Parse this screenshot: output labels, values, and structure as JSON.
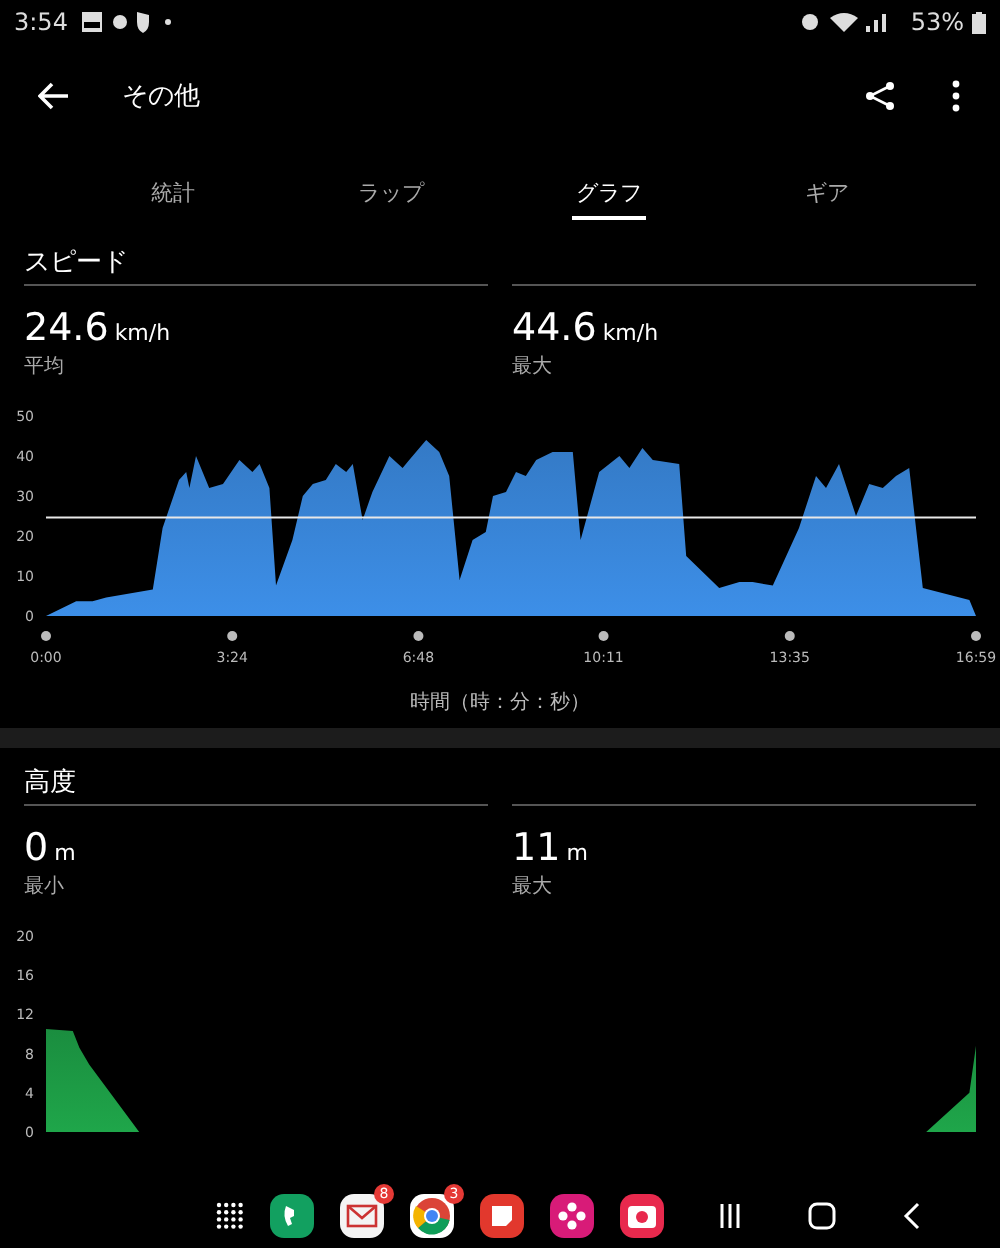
{
  "status_bar": {
    "time": "3:54",
    "battery": "53%"
  },
  "app_bar": {
    "title": "その他"
  },
  "tabs": [
    {
      "label": "統計",
      "selected": false
    },
    {
      "label": "ラップ",
      "selected": false
    },
    {
      "label": "グラフ",
      "selected": true
    },
    {
      "label": "ギア",
      "selected": false
    }
  ],
  "sections": [
    {
      "title": "スピード",
      "stats": [
        {
          "value": "24.6",
          "unit": "km/h",
          "label": "平均"
        },
        {
          "value": "44.6",
          "unit": "km/h",
          "label": "最大"
        }
      ],
      "chart_data": {
        "type": "area",
        "xlabel": "時間（時：分：秒）",
        "ylim": [
          0,
          50
        ],
        "xlim": [
          0,
          16.98
        ],
        "yticks": [
          0,
          10,
          20,
          30,
          40,
          50
        ],
        "xticks": [
          {
            "value": 0,
            "label": "0:00"
          },
          {
            "value": 3.4,
            "label": "3:24"
          },
          {
            "value": 6.8,
            "label": "6:48"
          },
          {
            "value": 10.18,
            "label": "10:11"
          },
          {
            "value": 13.58,
            "label": "13:35"
          },
          {
            "value": 16.98,
            "label": "16:59"
          }
        ],
        "x": [
          0,
          0.55,
          0.85,
          1.1,
          1.95,
          2.13,
          2.43,
          2.56,
          2.62,
          2.74,
          2.98,
          3.23,
          3.53,
          3.77,
          3.9,
          4.08,
          4.2,
          4.5,
          4.69,
          4.87,
          5.11,
          5.29,
          5.48,
          5.6,
          5.78,
          5.96,
          6.27,
          6.51,
          6.63,
          6.94,
          7.18,
          7.36,
          7.55,
          7.79,
          8.03,
          8.16,
          8.4,
          8.58,
          8.76,
          8.95,
          9.25,
          9.62,
          9.76,
          10.1,
          10.47,
          10.65,
          10.89,
          11.08,
          11.56,
          11.69,
          12.29,
          12.66,
          12.9,
          13.27,
          13.75,
          14.06,
          14.24,
          14.48,
          14.79,
          15.03,
          15.28,
          15.52,
          15.76,
          16.01,
          16.86,
          16.98
        ],
        "series": [
          {
            "color": "#3d8fe8",
            "values": [
              0,
              3.7,
              3.7,
              4.6,
              6.6,
              22,
              34,
              36,
              32,
              40,
              32,
              33,
              39,
              36,
              38,
              32,
              7.6,
              19,
              30,
              33,
              34,
              38,
              36,
              38,
              24,
              31,
              40,
              37,
              39,
              44,
              41,
              35,
              9,
              19,
              21,
              30,
              31,
              36,
              35,
              39,
              41,
              41,
              19,
              36,
              40,
              37,
              42,
              39,
              38,
              15,
              7,
              8.5,
              8.5,
              7.6,
              22,
              35,
              32,
              38,
              25,
              33,
              32,
              35,
              37,
              7,
              4,
              0
            ]
          }
        ],
        "ref_lines": [
          {
            "axis": "y",
            "value": 24.6
          }
        ]
      }
    },
    {
      "title": "高度",
      "stats": [
        {
          "value": "0",
          "unit": "m",
          "label": "最小"
        },
        {
          "value": "11",
          "unit": "m",
          "label": "最大"
        }
      ],
      "chart_data": {
        "type": "area",
        "ylim": [
          0,
          20
        ],
        "xlim": [
          0,
          16.98
        ],
        "yticks": [
          0,
          4,
          8,
          12,
          16,
          20
        ],
        "x": [
          0,
          0.49,
          0.61,
          0.79,
          1.7,
          16.07,
          16.86,
          16.98
        ],
        "series": [
          {
            "color": "#1fa64a",
            "values": [
              10.5,
              10.3,
              8.6,
              6.9,
              0,
              0,
              4,
              8.8
            ]
          }
        ]
      }
    }
  ],
  "dock": [
    {
      "kind": "apps"
    },
    {
      "kind": "phone"
    },
    {
      "kind": "mail",
      "badge": "8"
    },
    {
      "kind": "chrome",
      "badge": "3"
    },
    {
      "kind": "notes"
    },
    {
      "kind": "flower"
    },
    {
      "kind": "camera"
    }
  ]
}
